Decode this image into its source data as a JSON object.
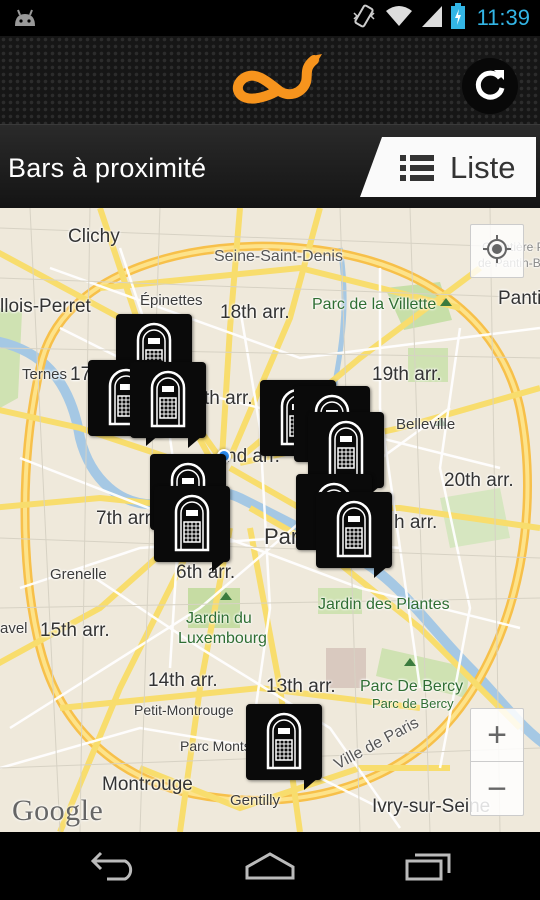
{
  "status_bar": {
    "time": "11:39",
    "icons": [
      "android-icon",
      "vibrate-icon",
      "wifi-icon",
      "signal-icon",
      "battery-charging-icon"
    ]
  },
  "app_bar": {
    "logo": "app-logo",
    "refresh_icon": "refresh-icon"
  },
  "title_bar": {
    "title": "Bars à proximité",
    "list_tab_label": "Liste",
    "list_tab_icon": "list-icon"
  },
  "map": {
    "labels": {
      "clichy": "Clichy",
      "seine_saint_denis": "Seine-Saint-Denis",
      "levallois": "llois-Perret",
      "epinettes": "Épinettes",
      "arr18": "18th arr.",
      "villette": "Parc de la Villette",
      "pantin": "Panti",
      "ternes": "Ternes",
      "arr17": "17",
      "arr8": "th arr.",
      "arr19": "19th arr.",
      "belleville": "Belleville",
      "arr2": "nd arr.",
      "arr20": "20th arr.",
      "arr7": "7th arr",
      "arr11": "h arr.",
      "paris": "Par",
      "grenelle": "Grenelle",
      "arr6": "6th arr.",
      "jardin_plantes": "Jardin des Plantes",
      "avel": "avel",
      "arr15": "15th arr.",
      "jardin_lux_1": "Jardin du",
      "jardin_lux_2": "Luxembourg",
      "arr14": "14th arr.",
      "arr13": "13th arr.",
      "parc_bercy_1": "Parc De Bercy",
      "parc_bercy_2": "Parc de Bercy",
      "petit_montrouge": "Petit-Montrouge",
      "parc_monts": "Parc Monts",
      "ville_paris": "Ville de Paris",
      "montrouge": "Montrouge",
      "gentilly": "Gentilly",
      "ivry": "Ivry-sur-Seine",
      "cimetiere_1": "Cimetière P",
      "cimetiere_2": "de Pantin-B"
    },
    "markers_count": 11,
    "marker_icon": "jukebox-icon",
    "controls": {
      "zoom_in": "+",
      "zoom_out": "−",
      "locate_icon": "locate-icon"
    },
    "attribution": "Google"
  },
  "nav_bar": {
    "icons": [
      "back-icon",
      "home-icon",
      "recent-apps-icon"
    ]
  },
  "colors": {
    "accent_orange": "#f7941d",
    "clock_blue": "#33b5e5",
    "road_yellow": "#f8dd6d"
  }
}
